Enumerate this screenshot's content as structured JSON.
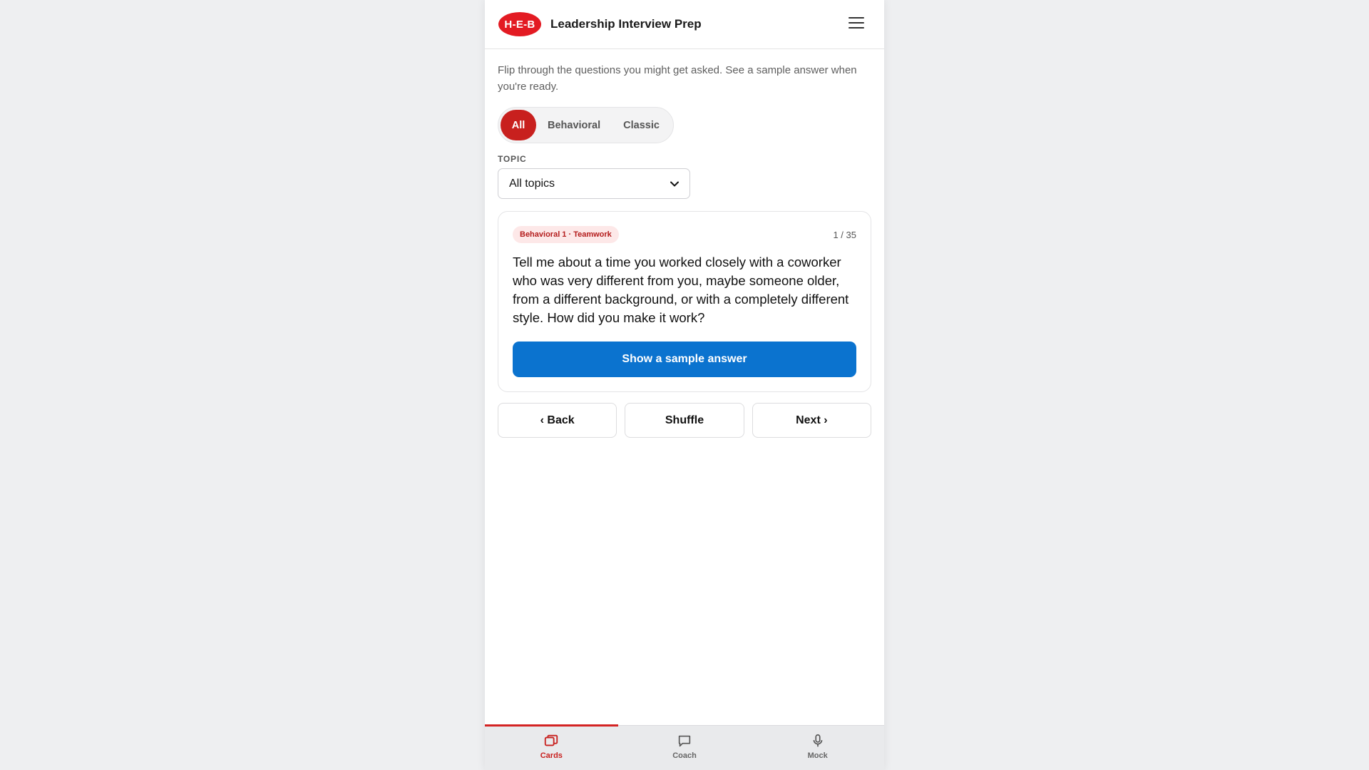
{
  "header": {
    "logo_text": "H-E-B",
    "title": "Leadership Interview Prep",
    "brand_color": "#e31b23"
  },
  "intro": "Flip through the questions you might get asked. See a sample answer when you're ready.",
  "filters": {
    "segments": [
      {
        "label": "All",
        "active": true
      },
      {
        "label": "Behavioral",
        "active": false
      },
      {
        "label": "Classic",
        "active": false
      }
    ]
  },
  "topic": {
    "label": "TOPIC",
    "selected": "All topics"
  },
  "card": {
    "tag": "Behavioral 1 · Teamwork",
    "counter": "1 / 35",
    "question": "Tell me about a time you worked closely with a coworker who was very different from you, maybe someone older, from a different background, or with a completely different style. How did you make it work?",
    "sample_button": "Show a sample answer",
    "accent_color": "#0b73cf"
  },
  "navigation": {
    "back": "‹ Back",
    "shuffle": "Shuffle",
    "next": "Next ›"
  },
  "tabbar": {
    "items": [
      {
        "label": "Cards",
        "icon": "cards-icon",
        "active": true
      },
      {
        "label": "Coach",
        "icon": "chat-bubble-icon",
        "active": false
      },
      {
        "label": "Mock",
        "icon": "microphone-icon",
        "active": false
      }
    ]
  }
}
